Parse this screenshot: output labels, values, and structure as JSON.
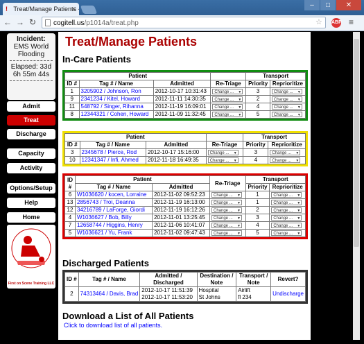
{
  "browser": {
    "tab_title": "Treat/Manage Patients - T",
    "url_host": "cogitell.us",
    "url_path": "/p1014a/treat.php"
  },
  "sidebar": {
    "incident_label": "Incident:",
    "incident_name": "EMS World Flooding",
    "elapsed": "Elapsed: 33d 6h 55m 44s",
    "nav": [
      "Admit",
      "Treat",
      "Discharge",
      "Capacity",
      "Activity",
      "Options/Setup",
      "Help",
      "Home"
    ],
    "active": "Treat",
    "logo_text": "First on Scene Training LLC"
  },
  "page": {
    "title": "Treat/Manage Patients",
    "incare_heading": "In-Care Patients",
    "discharged_heading": "Discharged Patients",
    "download_heading": "Download a List of All Patients",
    "download_link": "Click to download list of all patients."
  },
  "headers": {
    "patient": "Patient",
    "transport": "Transport",
    "id": "ID #",
    "tag": "Tag # / Name",
    "admitted": "Admitted",
    "retriage": "Re-Triage",
    "priority": "Priority",
    "reprioritize": "Reprioritize",
    "admitted_discharged": "Admitted / Discharged",
    "destination": "Destination / Note",
    "transport_note": "Transport / Note",
    "revert": "Revert?",
    "change": "Change ..."
  },
  "green_rows": [
    {
      "id": "1",
      "tag": "3205902 / Johnson, Ron",
      "admitted": "2012-10-17 10:31:43",
      "priority": "3"
    },
    {
      "id": "9",
      "tag": "2341234 / Kitel, Howard",
      "admitted": "2012-11-11 14:30:35",
      "priority": "2"
    },
    {
      "id": "11",
      "tag": "548792 / Singer, Rihanna",
      "admitted": "2012-11-19 16:09:01",
      "priority": "4"
    },
    {
      "id": "8",
      "tag": "12344321 / Cohen, Howard",
      "admitted": "2012-11-09 11:32:45",
      "priority": "5"
    }
  ],
  "yellow_rows": [
    {
      "id": "3",
      "tag": "2345678 / Pierce, Rod",
      "admitted": "2012-10-17 15:16:00",
      "priority": "3"
    },
    {
      "id": "10",
      "tag": "12341347 / Infi, Ahmed",
      "admitted": "2012-11-18 16:49:35",
      "priority": "4"
    }
  ],
  "red_rows": [
    {
      "id": "6",
      "tag": "W1036620 / kocen, Lorraine",
      "admitted": "2012-11-02 09:52:23",
      "priority": "1"
    },
    {
      "id": "13",
      "tag": "2856743 / Troi, Deanna",
      "admitted": "2012-11-19 16:13:00",
      "priority": "1"
    },
    {
      "id": "12",
      "tag": "34216789 / LaForge, Giordi",
      "admitted": "2012-11-19 16:12:26",
      "priority": "2"
    },
    {
      "id": "4",
      "tag": "W1036627 / Bob, Billy",
      "admitted": "2012-11-01 13:25:45",
      "priority": "3"
    },
    {
      "id": "7",
      "tag": "12658744 / Higgins, Henry",
      "admitted": "2012-11-06 10:41:07",
      "priority": "4"
    },
    {
      "id": "5",
      "tag": "W1036621 / Yu, Frank",
      "admitted": "2012-11-02 09:47:43",
      "priority": "5"
    }
  ],
  "discharged_rows": [
    {
      "id": "2",
      "tag": "74313464 / Davis, Brad",
      "admitted": "2012-10-17 11:51:39",
      "discharged": "2012-10-17 11:53:20",
      "dest1": "Hospital",
      "dest2": "St Johns",
      "trans1": "Airlift",
      "trans2": "fl 234",
      "revert": "Undischarge"
    }
  ]
}
